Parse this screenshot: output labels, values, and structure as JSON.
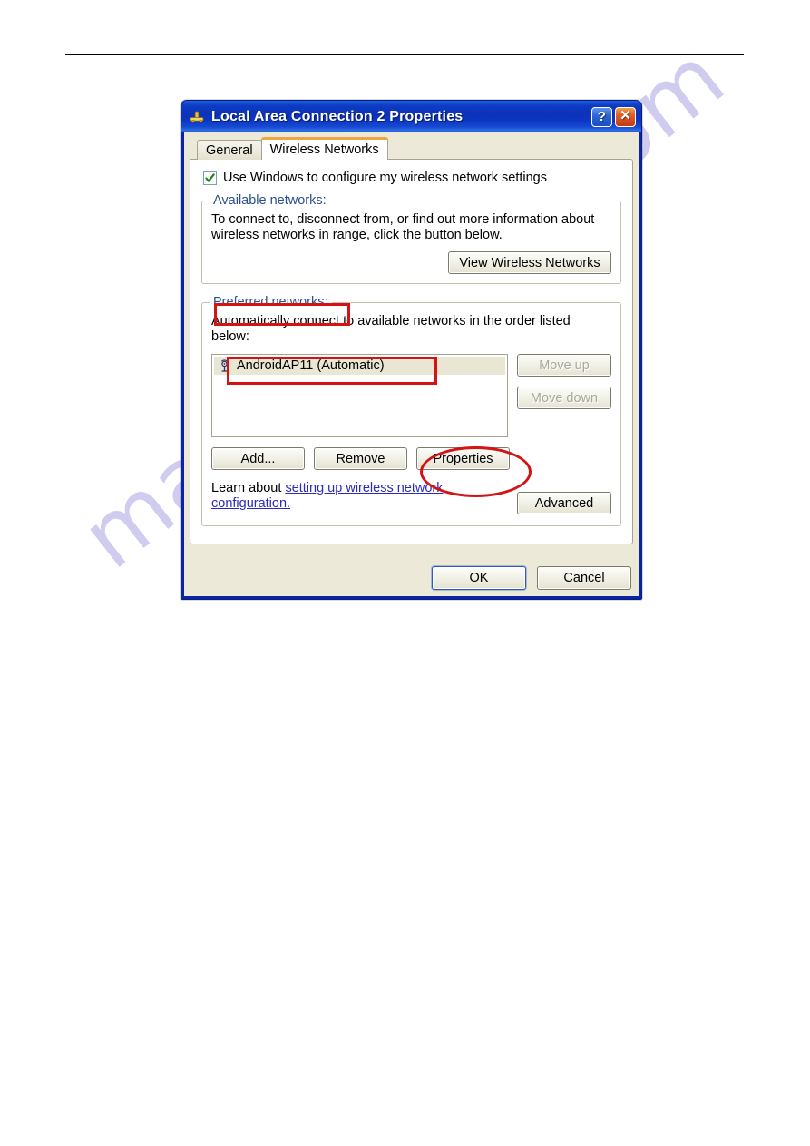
{
  "page": {
    "watermark": "manualshive.com",
    "rule": "horizontal-rule"
  },
  "dialog": {
    "title": "Local Area Connection 2 Properties",
    "icon": "network-connection-icon",
    "title_buttons": {
      "help": "?",
      "close": "✕"
    },
    "tabs": [
      {
        "label": "General",
        "active": false
      },
      {
        "label": "Wireless Networks",
        "active": true
      }
    ],
    "use_windows_checkbox": {
      "label": "Use Windows to configure my wireless network settings",
      "checked": true
    },
    "available_networks": {
      "legend": "Available networks:",
      "description": "To connect to, disconnect from, or find out more information about wireless networks in range, click the button below.",
      "view_button": "View Wireless Networks"
    },
    "preferred_networks": {
      "legend": "Preferred networks:",
      "description": "Automatically connect to available networks in the order listed below:",
      "items": [
        {
          "name": "AndroidAP11 (Automatic)",
          "icon": "wireless-signal-icon",
          "selected": true
        }
      ],
      "move_up": "Move up",
      "move_down": "Move down",
      "move_up_disabled": true,
      "move_down_disabled": true,
      "add_button": "Add...",
      "remove_button": "Remove",
      "properties_button": "Properties"
    },
    "learn_more": {
      "prefix": "Learn about ",
      "link": "setting up wireless network configuration.",
      "advanced_button": "Advanced"
    },
    "footer": {
      "ok": "OK",
      "cancel": "Cancel"
    }
  },
  "annotations": {
    "accent_color": "#d61313",
    "items": [
      {
        "name": "preferred-networks-label-highlight",
        "shape": "rect"
      },
      {
        "name": "android-ap-list-item-highlight",
        "shape": "rect"
      },
      {
        "name": "properties-button-highlight",
        "shape": "ellipse"
      }
    ]
  }
}
